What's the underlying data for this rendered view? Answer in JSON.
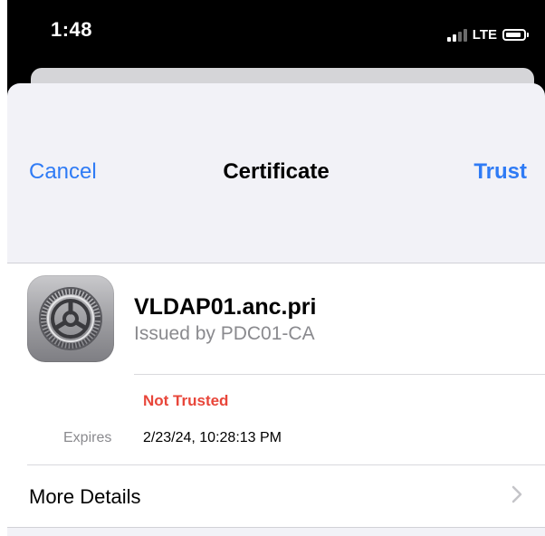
{
  "status_bar": {
    "time": "1:48",
    "network": "LTE"
  },
  "nav": {
    "cancel_label": "Cancel",
    "title": "Certificate",
    "trust_label": "Trust"
  },
  "certificate": {
    "name": "VLDAP01.anc.pri",
    "issuer": "Issued by PDC01-CA",
    "icon": "settings-gear-icon",
    "status": "Not Trusted",
    "expires_label": "Expires",
    "expires_value": "2/23/24, 10:28:13 PM"
  },
  "more_details_label": "More Details",
  "colors": {
    "accent": "#2f7bf5",
    "warning": "#e8463a",
    "secondary_text": "#8a8a8e"
  }
}
